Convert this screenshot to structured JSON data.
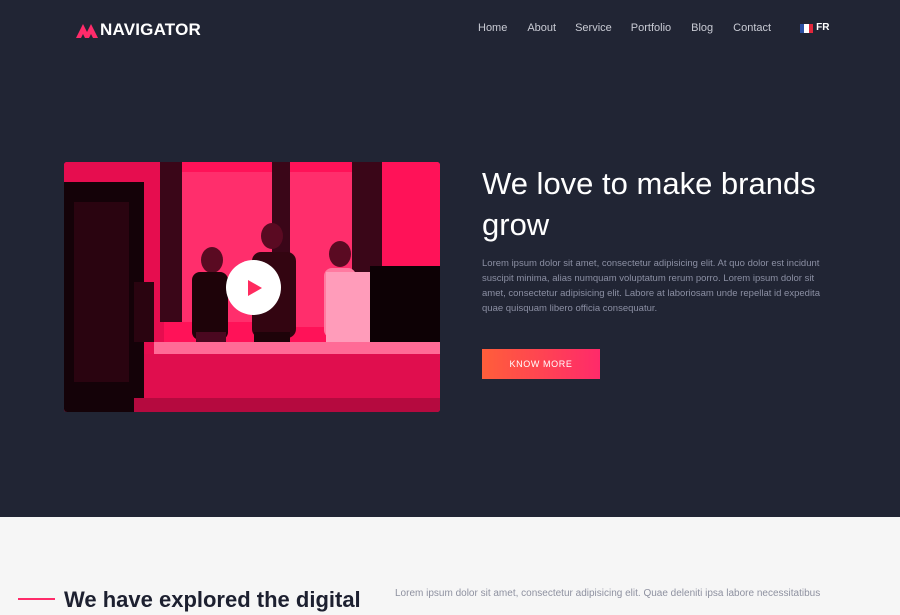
{
  "brand": {
    "logo_text": "NAVIGATOR",
    "accent_color": "#ff2b6a"
  },
  "nav": {
    "items": [
      "Home",
      "About",
      "Service",
      "Portfolio",
      "Blog",
      "Contact"
    ],
    "language": "FR",
    "language_icon": "france-flag-icon"
  },
  "hero": {
    "title": "We love to make brands grow",
    "body": "Lorem ipsum dolor sit amet, consectetur adipisicing elit. At quo dolor est incidunt suscipit minima, alias numquam voluptatum rerum porro. Lorem ipsum dolor sit amet, consectetur adipisicing elit. Labore at laboriosam unde repellat id expedita quae quisquam libero officia consequatur.",
    "cta_label": "KNOW MORE",
    "video_icon": "play-icon",
    "background_color": "#212534"
  },
  "section": {
    "title": "We have explored the digital",
    "body": "Lorem ipsum dolor sit amet, consectetur adipisicing elit. Quae deleniti ipsa labore necessitatibus"
  }
}
